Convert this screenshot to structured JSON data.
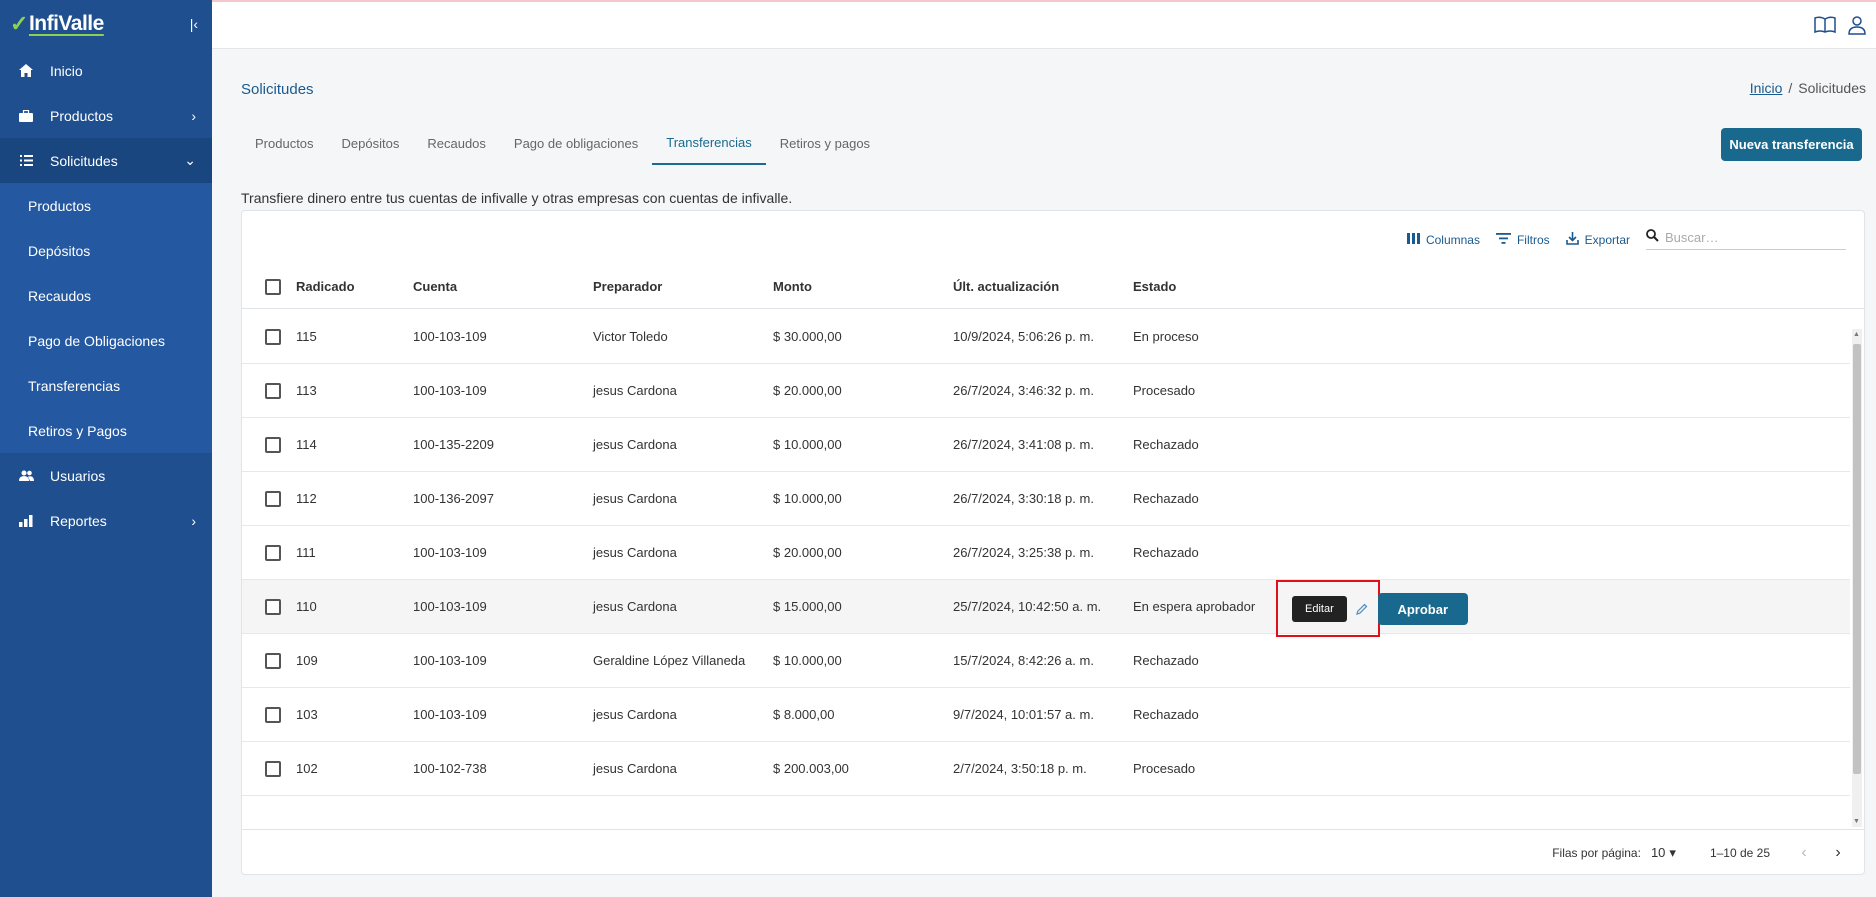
{
  "app": {
    "brand": "InfiValle"
  },
  "sidebar": {
    "items": [
      {
        "label": "Inicio"
      },
      {
        "label": "Productos"
      },
      {
        "label": "Solicitudes"
      },
      {
        "label": "Usuarios"
      },
      {
        "label": "Reportes"
      }
    ],
    "subitems": [
      {
        "label": "Productos"
      },
      {
        "label": "Depósitos"
      },
      {
        "label": "Recaudos"
      },
      {
        "label": "Pago de Obligaciones"
      },
      {
        "label": "Transferencias"
      },
      {
        "label": "Retiros y Pagos"
      }
    ]
  },
  "page": {
    "title": "Solicitudes",
    "breadcrumb": {
      "home": "Inicio",
      "current": "Solicitudes"
    },
    "tabs": [
      "Productos",
      "Depósitos",
      "Recaudos",
      "Pago de obligaciones",
      "Transferencias",
      "Retiros y pagos"
    ],
    "active_tab": "Transferencias",
    "new_button": "Nueva transferencia",
    "description": "Transfiere dinero entre tus cuentas de infivalle y otras empresas con cuentas de infivalle."
  },
  "toolbar": {
    "columns": "Columnas",
    "filters": "Filtros",
    "export": "Exportar",
    "search_placeholder": "Buscar…"
  },
  "table": {
    "headers": [
      "Radicado",
      "Cuenta",
      "Preparador",
      "Monto",
      "Últ. actualización",
      "Estado"
    ],
    "rows": [
      [
        "115",
        "100-103-109",
        "Victor Toledo",
        "$ 30.000,00",
        "10/9/2024, 5:06:26 p. m.",
        "En proceso"
      ],
      [
        "113",
        "100-103-109",
        "jesus Cardona",
        "$ 20.000,00",
        "26/7/2024, 3:46:32 p. m.",
        "Procesado"
      ],
      [
        "114",
        "100-135-2209",
        "jesus Cardona",
        "$ 10.000,00",
        "26/7/2024, 3:41:08 p. m.",
        "Rechazado"
      ],
      [
        "112",
        "100-136-2097",
        "jesus Cardona",
        "$ 10.000,00",
        "26/7/2024, 3:30:18 p. m.",
        "Rechazado"
      ],
      [
        "111",
        "100-103-109",
        "jesus Cardona",
        "$ 20.000,00",
        "26/7/2024, 3:25:38 p. m.",
        "Rechazado"
      ],
      [
        "110",
        "100-103-109",
        "jesus Cardona",
        "$ 15.000,00",
        "25/7/2024, 10:42:50 a. m.",
        "En espera aprobador"
      ],
      [
        "109",
        "100-103-109",
        "Geraldine López Villaneda",
        "$ 10.000,00",
        "15/7/2024, 8:42:26 a. m.",
        "Rechazado"
      ],
      [
        "103",
        "100-103-109",
        "jesus Cardona",
        "$ 8.000,00",
        "9/7/2024, 10:01:57 a. m.",
        "Rechazado"
      ],
      [
        "102",
        "100-102-738",
        "jesus Cardona",
        "$ 200.003,00",
        "2/7/2024, 3:50:18 p. m.",
        "Procesado"
      ]
    ],
    "row_actions": {
      "tooltip": "Editar",
      "approve": "Aprobar"
    }
  },
  "pagination": {
    "rows_per_page_label": "Filas por página:",
    "rows_per_page": "10",
    "range": "1–10 de 25"
  },
  "colors": {
    "sidebar": "#1f4f8f",
    "accent": "#19698e",
    "highlight_border": "#e0101a"
  }
}
